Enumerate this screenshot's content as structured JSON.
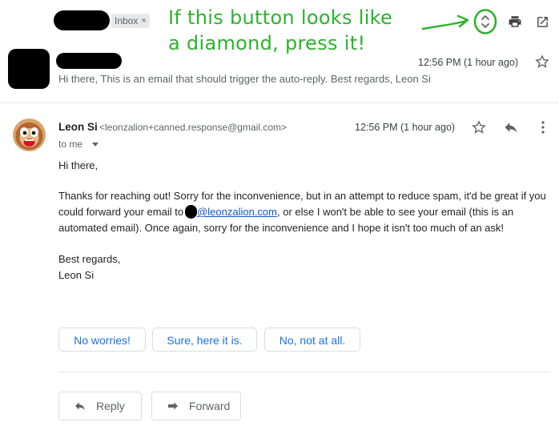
{
  "thread": {
    "label_chip": "Inbox",
    "label_chip_close": "×",
    "time": "12:56 PM (1 hour ago)",
    "preview": "Hi there, This is an email that should trigger the auto-reply. Best regards, Leon Si"
  },
  "annotation": {
    "line1": "If this button looks like",
    "line2": "a diamond, press it!",
    "color": "#2bb32b"
  },
  "message": {
    "sender_name": "Leon Si",
    "sender_email": "<leonzalion+canned.response@gmail.com>",
    "time": "12:56 PM (1 hour ago)",
    "to": "to me",
    "greeting": "Hi there,",
    "para_line1": "Thanks for reaching out! Sorry for the inconvenience, but in an attempt to reduce spam, it'd be great if you",
    "para_line2_pre": "could forward your email to",
    "para_line2_link": "@leonzalion.com",
    "para_line2_post": ", or else I won't be able to see your email (this is an",
    "para_line3": "automated email). Once again, sorry for the inconvenience and I hope it isn't too much of an ask!",
    "signoff": "Best regards,",
    "signature": "Leon Si"
  },
  "smart_replies": [
    "No worries!",
    "Sure, here it is.",
    "No, not at all."
  ],
  "actions": {
    "reply": "Reply",
    "forward": "Forward"
  },
  "icons": [
    "expand-collapse-icon",
    "print-icon",
    "open-in-new-window-icon",
    "star-icon",
    "reply-icon",
    "more-vert-icon"
  ],
  "colors": {
    "link": "#1155cc",
    "smart_reply_text": "#1a73e8",
    "annotation_green": "#2bb32b"
  }
}
